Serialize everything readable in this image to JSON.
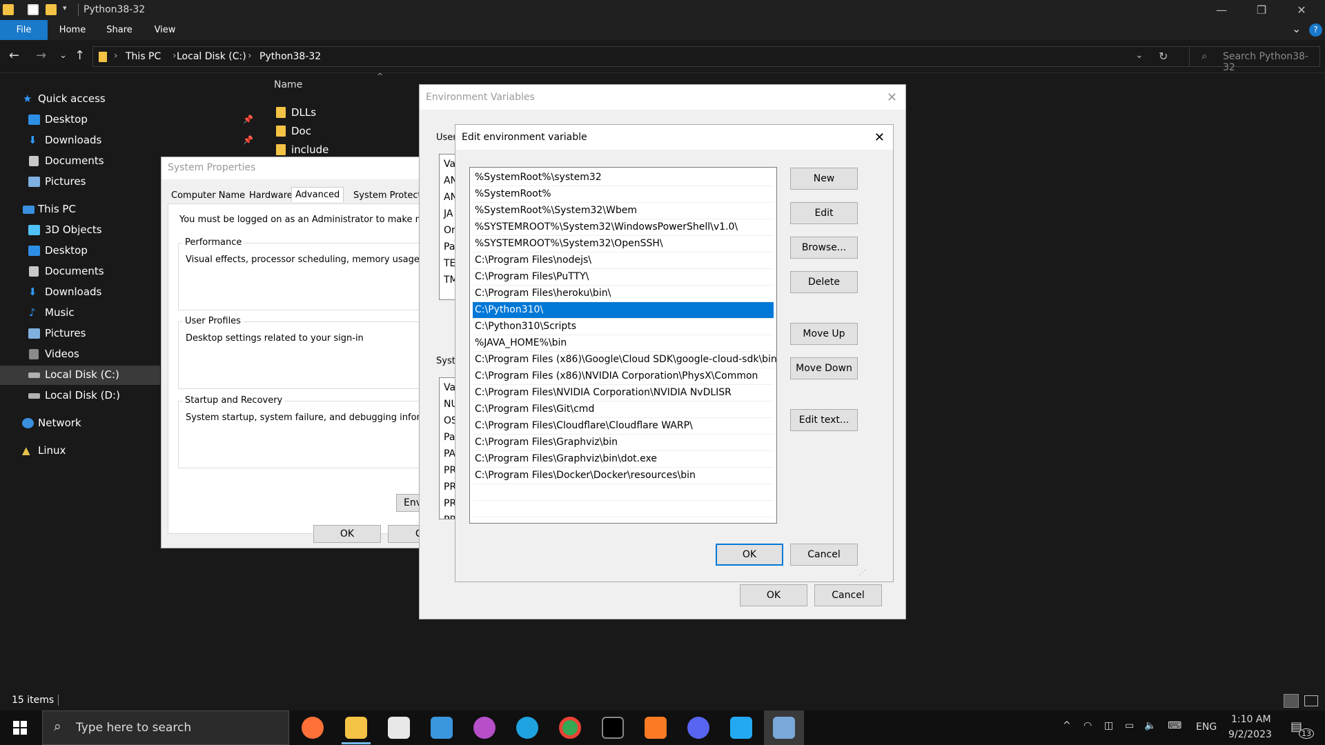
{
  "window": {
    "title": "Python38-32"
  },
  "ribbon": {
    "tabs": [
      "File",
      "Home",
      "Share",
      "View"
    ]
  },
  "address": {
    "crumbs": [
      "This PC",
      "Local Disk (C:)",
      "Python38-32"
    ],
    "search_placeholder": "Search Python38-32"
  },
  "navpane": {
    "quick_access": "Quick access",
    "quick_items": [
      "Desktop",
      "Downloads",
      "Documents",
      "Pictures"
    ],
    "this_pc": "This PC",
    "pc_items": [
      "3D Objects",
      "Desktop",
      "Documents",
      "Downloads",
      "Music",
      "Pictures",
      "Videos",
      "Local Disk (C:)",
      "Local Disk (D:)"
    ],
    "network": "Network",
    "linux": "Linux"
  },
  "filelist": {
    "col_name": "Name",
    "files": [
      "DLLs",
      "Doc",
      "include"
    ]
  },
  "status": {
    "items": "15 items"
  },
  "system_properties": {
    "title": "System Properties",
    "tabs": [
      "Computer Name",
      "Hardware",
      "Advanced",
      "System Protection"
    ],
    "admin_note": "You must be logged on as an Administrator to make most c",
    "performance": {
      "label": "Performance",
      "desc": "Visual effects, processor scheduling, memory usage, and"
    },
    "user_profiles": {
      "label": "User Profiles",
      "desc": "Desktop settings related to your sign-in"
    },
    "startup": {
      "label": "Startup and Recovery",
      "desc": "System startup, system failure, and debugging informatio"
    },
    "env_button": "Env",
    "ok": "OK",
    "cancel": "Ca"
  },
  "env_vars": {
    "title": "Environment Variables",
    "user_label": "User",
    "system_label": "Syste",
    "user_rows": [
      "Va",
      "AN",
      "AN",
      "JA",
      "Or",
      "Pa",
      "TE",
      "TM"
    ],
    "system_rows": [
      "Va",
      "NU",
      "OS",
      "Pa",
      "PA",
      "PR",
      "PR",
      "PR",
      "PR"
    ],
    "ok": "OK",
    "cancel": "Cancel"
  },
  "edit_env": {
    "title": "Edit environment variable",
    "paths": [
      "%SystemRoot%\\system32",
      "%SystemRoot%",
      "%SystemRoot%\\System32\\Wbem",
      "%SYSTEMROOT%\\System32\\WindowsPowerShell\\v1.0\\",
      "%SYSTEMROOT%\\System32\\OpenSSH\\",
      "C:\\Program Files\\nodejs\\",
      "C:\\Program Files\\PuTTY\\",
      "C:\\Program Files\\heroku\\bin\\",
      "C:\\Python310\\",
      "C:\\Python310\\Scripts",
      "%JAVA_HOME%\\bin",
      "C:\\Program Files (x86)\\Google\\Cloud SDK\\google-cloud-sdk\\bin",
      "C:\\Program Files (x86)\\NVIDIA Corporation\\PhysX\\Common",
      "C:\\Program Files\\NVIDIA Corporation\\NVIDIA NvDLISR",
      "C:\\Program Files\\Git\\cmd",
      "C:\\Program Files\\Cloudflare\\Cloudflare WARP\\",
      "C:\\Program Files\\Graphviz\\bin",
      "C:\\Program Files\\Graphviz\\bin\\dot.exe",
      "C:\\Program Files\\Docker\\Docker\\resources\\bin"
    ],
    "selected_index": 8,
    "buttons": {
      "new": "New",
      "edit": "Edit",
      "browse": "Browse...",
      "delete": "Delete",
      "move_up": "Move Up",
      "move_down": "Move Down",
      "edit_text": "Edit text..."
    },
    "ok": "OK",
    "cancel": "Cancel"
  },
  "taskbar": {
    "search_placeholder": "Type here to search",
    "lang": "ENG",
    "time": "1:10 AM",
    "date": "9/2/2023",
    "notif_count": "13"
  },
  "colors": {
    "accent": "#0078d7",
    "file_tab": "#1979ca",
    "folder": "#f4c244"
  }
}
